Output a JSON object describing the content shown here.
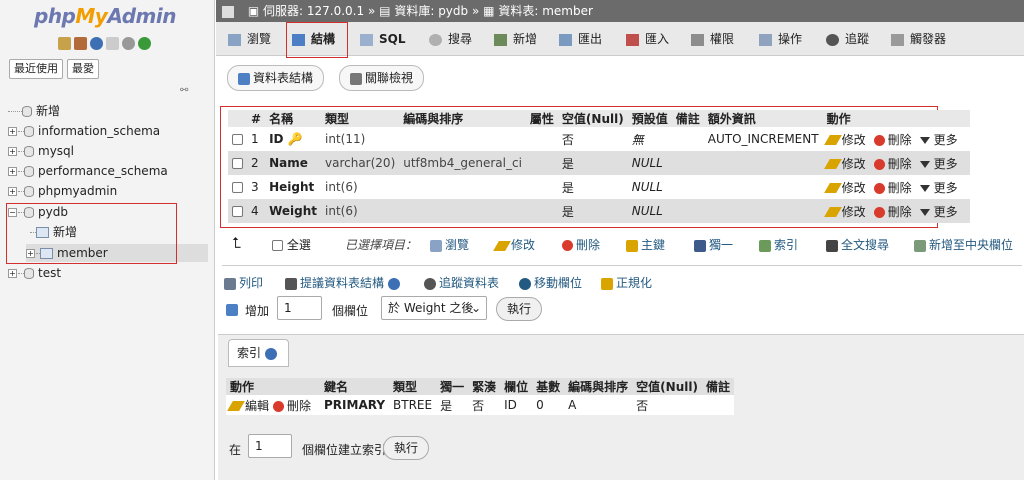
{
  "sidebar": {
    "logo_php": "php",
    "logo_my": "My",
    "logo_admin": "Admin",
    "recent_button": "最近使用",
    "favorites_button": "最愛",
    "new_label": "新增",
    "databases": [
      "information_schema",
      "mysql",
      "performance_schema",
      "phpmyadmin",
      "pydb"
    ],
    "pydb_children": [
      "新增",
      "member"
    ],
    "last_db": "test"
  },
  "breadcrumb": {
    "server_label": "伺服器:",
    "server": "127.0.0.1",
    "sep": "»",
    "database_label": "資料庫:",
    "database": "pydb",
    "table_label": "資料表:",
    "table": "member"
  },
  "tabs": [
    "瀏覽",
    "結構",
    "SQL",
    "搜尋",
    "新增",
    "匯出",
    "匯入",
    "權限",
    "操作",
    "追蹤",
    "觸發器"
  ],
  "subtabs": {
    "table_structure": "資料表結構",
    "relation_view": "關聯檢視"
  },
  "structure": {
    "headers": [
      "#",
      "名稱",
      "類型",
      "編碼與排序",
      "屬性",
      "空值(Null)",
      "預設值",
      "備註",
      "額外資訊",
      "動作"
    ],
    "rows": [
      {
        "num": "1",
        "name": "ID",
        "type": "int(11)",
        "collation": "",
        "null": "否",
        "default": "無",
        "extra": "AUTO_INCREMENT"
      },
      {
        "num": "2",
        "name": "Name",
        "type": "varchar(20)",
        "collation": "utf8mb4_general_ci",
        "null": "是",
        "default": "NULL",
        "extra": ""
      },
      {
        "num": "3",
        "name": "Height",
        "type": "int(6)",
        "collation": "",
        "null": "是",
        "default": "NULL",
        "extra": ""
      },
      {
        "num": "4",
        "name": "Weight",
        "type": "int(6)",
        "collation": "",
        "null": "是",
        "default": "NULL",
        "extra": ""
      }
    ],
    "action_edit": "修改",
    "action_delete": "刪除",
    "action_more": "更多"
  },
  "bulk": {
    "check_all": "全選",
    "selected": "已選擇項目：",
    "browse": "瀏覽",
    "edit": "修改",
    "delete": "刪除",
    "primary": "主鍵",
    "unique": "獨一",
    "index": "索引",
    "fulltext": "全文搜尋",
    "central": "新增至中央欄位"
  },
  "links": {
    "print": "列印",
    "propose": "提議資料表結構",
    "track": "追蹤資料表",
    "move_columns": "移動欄位",
    "normalize": "正規化"
  },
  "add_columns": {
    "label": "增加",
    "count": "1",
    "unit": "個欄位",
    "position": "於 Weight 之後",
    "go": "執行"
  },
  "indexes": {
    "legend": "索引",
    "headers": [
      "動作",
      "鍵名",
      "類型",
      "獨一",
      "緊湊",
      "欄位",
      "基數",
      "編碼與排序",
      "空值(Null)",
      "備註"
    ],
    "row": {
      "edit": "編輯",
      "delete": "刪除",
      "keyname": "PRIMARY",
      "type": "BTREE",
      "unique": "是",
      "packed": "否",
      "column": "ID",
      "cardinality": "0",
      "collation": "A",
      "null": "否",
      "comment": ""
    },
    "create_prefix": "在",
    "create_count": "1",
    "create_suffix": "個欄位建立索引",
    "go": "執行"
  },
  "colors": {
    "accent_red": "#d32f2f",
    "topbar": "#6b6b6b",
    "link": "#235a81",
    "logo_blue": "#6c78af",
    "logo_orange": "#f29d00"
  }
}
